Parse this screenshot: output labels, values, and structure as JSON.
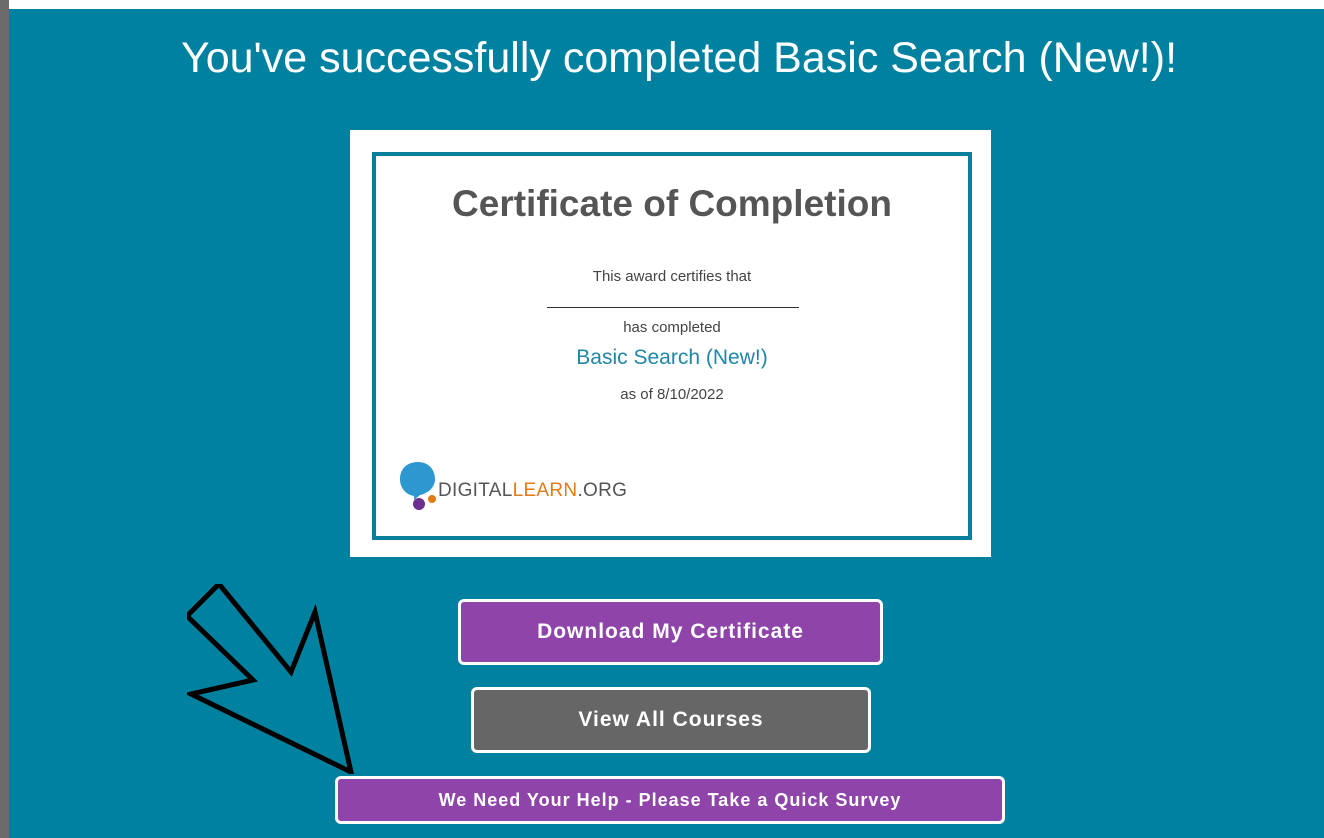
{
  "header": {
    "headline": "You've successfully completed Basic Search (New!)!"
  },
  "certificate": {
    "title": "Certificate of Completion",
    "certifies": "This award certifies that",
    "completed": "has completed",
    "course": "Basic Search (New!)",
    "date": "as of 8/10/2022",
    "logo": {
      "part1": "DIGITAL",
      "part2": "LEARN",
      "part3": ".ORG",
      "icon": "digitallearn-logo-icon"
    }
  },
  "actions": {
    "download_label": "Download My Certificate",
    "courses_label": "View All Courses",
    "survey_label": "We Need Your Help - Please Take a Quick Survey"
  },
  "annotation": {
    "icon": "arrow-pointer-icon"
  },
  "colors": {
    "panel": "#0081a0",
    "accent_purple": "#8e44a8",
    "gray_button": "#666666",
    "cert_border": "#0a7f9c",
    "course_text": "#1f86a8",
    "logo_orange": "#e07b16"
  }
}
